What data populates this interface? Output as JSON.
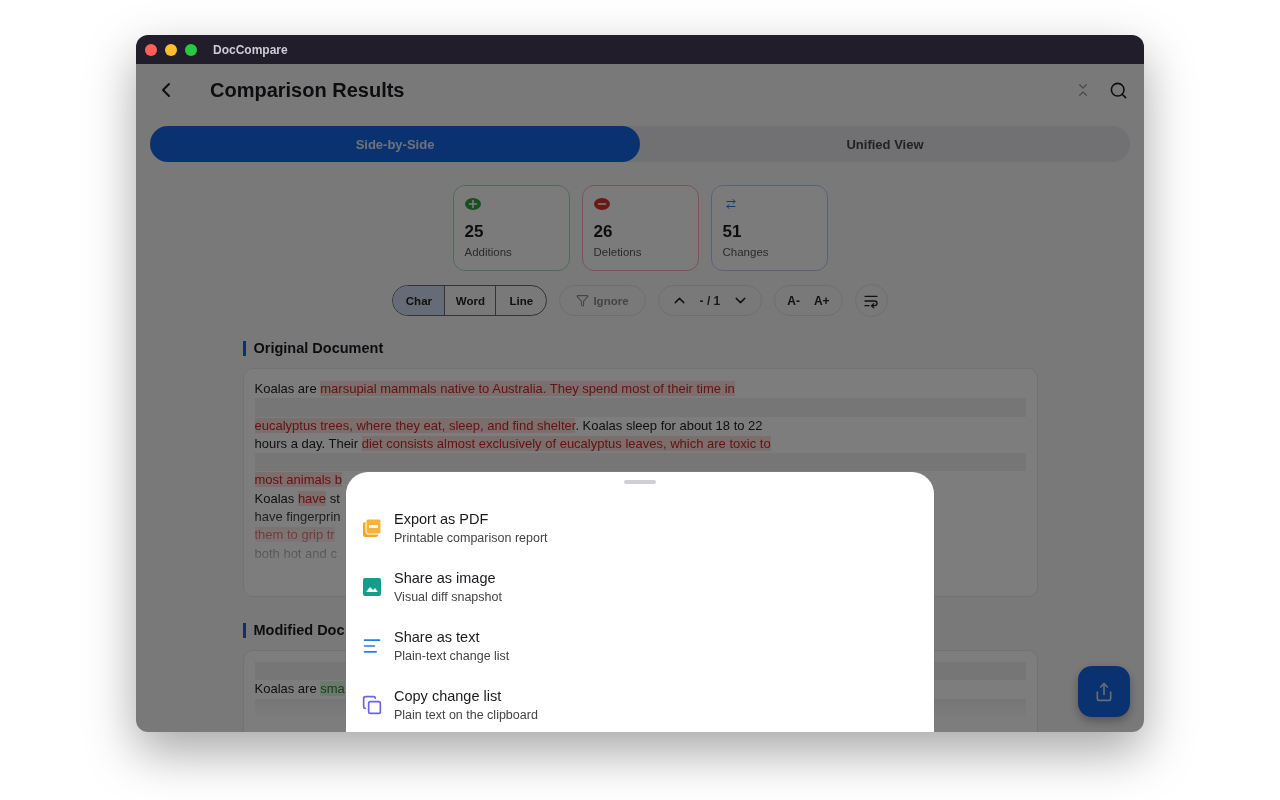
{
  "window": {
    "title": "DocCompare"
  },
  "header": {
    "title": "Comparison Results"
  },
  "tabs": [
    {
      "label": "Side-by-Side",
      "selected": true
    },
    {
      "label": "Unified View",
      "selected": false
    }
  ],
  "stats": [
    {
      "kind": "additions",
      "value": "25",
      "label": "Additions"
    },
    {
      "kind": "deletions",
      "value": "26",
      "label": "Deletions"
    },
    {
      "kind": "changes",
      "value": "51",
      "label": "Changes"
    }
  ],
  "granularity": [
    {
      "label": "Char",
      "selected": true
    },
    {
      "label": "Word",
      "selected": false
    },
    {
      "label": "Line",
      "selected": false
    }
  ],
  "ignore": {
    "label": "Ignore",
    "disabled": true
  },
  "navigator": {
    "position": "- / 1"
  },
  "font_size": {
    "decrease": "A-",
    "increase": "A+"
  },
  "documents": [
    {
      "title": "Original Document",
      "lines": [
        {
          "kind": "text",
          "segments": [
            {
              "kind": "plain",
              "text": "Koalas are "
            },
            {
              "kind": "deleted",
              "text": "marsupial mammals native to Australia. They spend most of their time in"
            }
          ]
        },
        {
          "kind": "gap"
        },
        {
          "kind": "text",
          "segments": [
            {
              "kind": "deleted",
              "text": "eucalyptus trees, where they eat, sleep, and find shelter"
            },
            {
              "kind": "plain",
              "text": ". Koalas sleep for about 18 to 22"
            }
          ]
        },
        {
          "kind": "text",
          "segments": [
            {
              "kind": "plain",
              "text": "hours a day. Their "
            },
            {
              "kind": "deleted",
              "text": "diet consists almost exclusively of eucalyptus leaves, which are toxic to"
            }
          ]
        },
        {
          "kind": "gap"
        },
        {
          "kind": "text",
          "segments": [
            {
              "kind": "deleted",
              "text": "most animals b"
            }
          ]
        },
        {
          "kind": "text",
          "segments": [
            {
              "kind": "plain",
              "text": "Koalas "
            },
            {
              "kind": "deleted",
              "text": "have"
            },
            {
              "kind": "plain",
              "text": " st"
            }
          ]
        },
        {
          "kind": "text",
          "segments": [
            {
              "kind": "plain",
              "text": "have fingerprin"
            }
          ]
        },
        {
          "kind": "text",
          "segments": [
            {
              "kind": "deleted",
              "text": "them to grip tr"
            }
          ]
        },
        {
          "kind": "text",
          "segments": [
            {
              "kind": "plain",
              "text": "both hot and c"
            }
          ]
        }
      ]
    },
    {
      "title": "Modified Doc",
      "lines": [
        {
          "kind": "gap"
        },
        {
          "kind": "text",
          "segments": [
            {
              "kind": "plain",
              "text": "Koalas are "
            },
            {
              "kind": "added",
              "text": "sma"
            }
          ]
        },
        {
          "kind": "gap"
        }
      ]
    }
  ],
  "share_sheet": {
    "items": [
      {
        "kind": "pdf",
        "title": "Export as PDF",
        "subtitle": "Printable comparison report"
      },
      {
        "kind": "image",
        "title": "Share as image",
        "subtitle": "Visual diff snapshot"
      },
      {
        "kind": "text",
        "title": "Share as text",
        "subtitle": "Plain-text change list"
      },
      {
        "kind": "copy",
        "title": "Copy change list",
        "subtitle": "Plain text on the clipboard"
      }
    ]
  }
}
